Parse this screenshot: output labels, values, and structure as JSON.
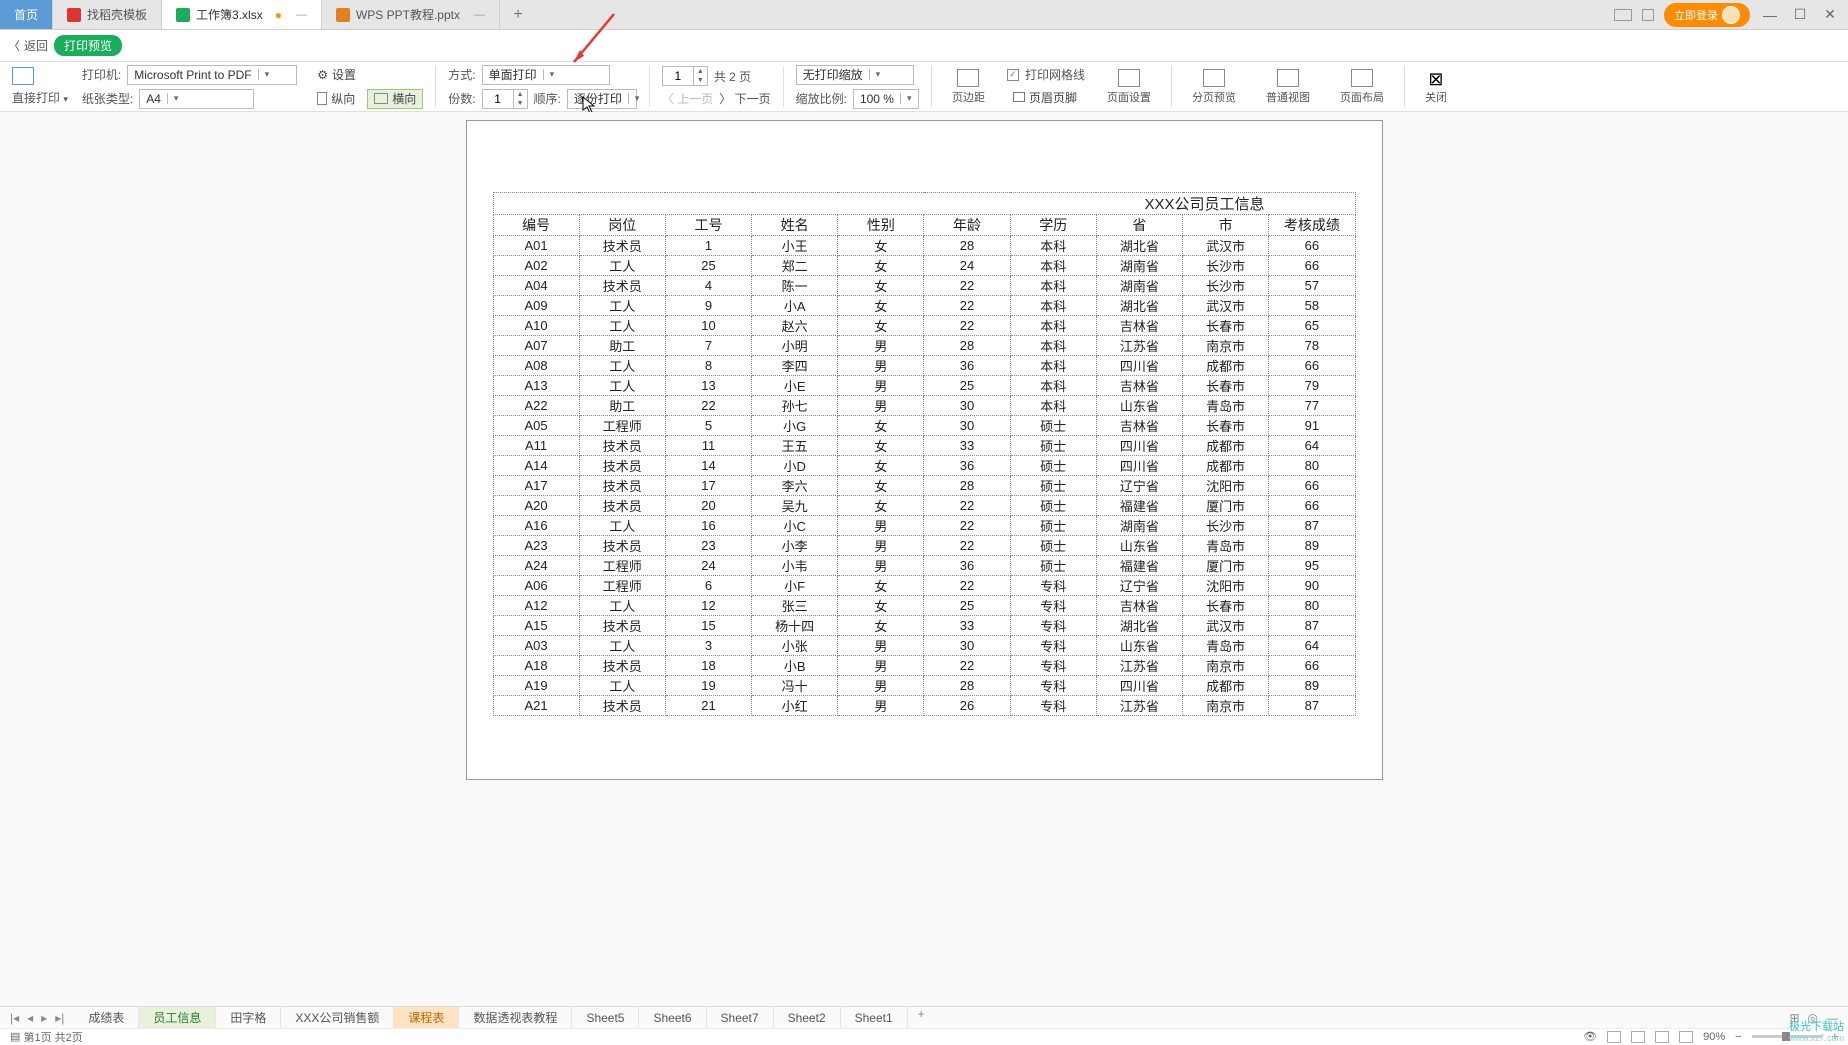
{
  "tabs": {
    "home": "首页",
    "t1": "找稻壳模板",
    "t2": "工作簿3.xlsx",
    "t3": "WPS PPT教程.pptx"
  },
  "topright": {
    "login": "立即登录"
  },
  "subbar": {
    "back": "返回",
    "badge": "打印预览"
  },
  "toolbar": {
    "direct_print": "直接打印",
    "printer_lbl": "打印机:",
    "printer_val": "Microsoft Print to PDF",
    "paper_lbl": "纸张类型:",
    "paper_val": "A4",
    "settings": "设置",
    "portrait": "纵向",
    "landscape": "横向",
    "mode_lbl": "方式:",
    "mode_val": "单面打印",
    "copies_lbl": "份数:",
    "copies_val": "1",
    "order_lbl": "顺序:",
    "order_val": "逐份打印",
    "page_val": "1",
    "total_pages": "共 2 页",
    "prev": "上一页",
    "next": "下一页",
    "scale_mode": "无打印缩放",
    "scale_lbl": "缩放比例:",
    "scale_val": "100 %",
    "margins": "页边距",
    "gridlines": "打印网格线",
    "headerfooter": "页眉页脚",
    "pagesetup": "页面设置",
    "pagebreak": "分页预览",
    "normalview": "普通视图",
    "pagelayout": "页面布局",
    "close": "关闭"
  },
  "table": {
    "title": "XXX公司员工信息",
    "headers": [
      "编号",
      "岗位",
      "工号",
      "姓名",
      "性别",
      "年龄",
      "学历",
      "省",
      "市",
      "考核成绩"
    ],
    "rows": [
      [
        "A01",
        "技术员",
        "1",
        "小王",
        "女",
        "28",
        "本科",
        "湖北省",
        "武汉市",
        "66"
      ],
      [
        "A02",
        "工人",
        "25",
        "郑二",
        "女",
        "24",
        "本科",
        "湖南省",
        "长沙市",
        "66"
      ],
      [
        "A04",
        "技术员",
        "4",
        "陈一",
        "女",
        "22",
        "本科",
        "湖南省",
        "长沙市",
        "57"
      ],
      [
        "A09",
        "工人",
        "9",
        "小A",
        "女",
        "22",
        "本科",
        "湖北省",
        "武汉市",
        "58"
      ],
      [
        "A10",
        "工人",
        "10",
        "赵六",
        "女",
        "22",
        "本科",
        "吉林省",
        "长春市",
        "65"
      ],
      [
        "A07",
        "助工",
        "7",
        "小明",
        "男",
        "28",
        "本科",
        "江苏省",
        "南京市",
        "78"
      ],
      [
        "A08",
        "工人",
        "8",
        "李四",
        "男",
        "36",
        "本科",
        "四川省",
        "成都市",
        "66"
      ],
      [
        "A13",
        "工人",
        "13",
        "小E",
        "男",
        "25",
        "本科",
        "吉林省",
        "长春市",
        "79"
      ],
      [
        "A22",
        "助工",
        "22",
        "孙七",
        "男",
        "30",
        "本科",
        "山东省",
        "青岛市",
        "77"
      ],
      [
        "A05",
        "工程师",
        "5",
        "小G",
        "女",
        "30",
        "硕士",
        "吉林省",
        "长春市",
        "91"
      ],
      [
        "A11",
        "技术员",
        "11",
        "王五",
        "女",
        "33",
        "硕士",
        "四川省",
        "成都市",
        "64"
      ],
      [
        "A14",
        "技术员",
        "14",
        "小D",
        "女",
        "36",
        "硕士",
        "四川省",
        "成都市",
        "80"
      ],
      [
        "A17",
        "技术员",
        "17",
        "李六",
        "女",
        "28",
        "硕士",
        "辽宁省",
        "沈阳市",
        "66"
      ],
      [
        "A20",
        "技术员",
        "20",
        "吴九",
        "女",
        "22",
        "硕士",
        "福建省",
        "厦门市",
        "66"
      ],
      [
        "A16",
        "工人",
        "16",
        "小C",
        "男",
        "22",
        "硕士",
        "湖南省",
        "长沙市",
        "87"
      ],
      [
        "A23",
        "技术员",
        "23",
        "小李",
        "男",
        "22",
        "硕士",
        "山东省",
        "青岛市",
        "89"
      ],
      [
        "A24",
        "工程师",
        "24",
        "小韦",
        "男",
        "36",
        "硕士",
        "福建省",
        "厦门市",
        "95"
      ],
      [
        "A06",
        "工程师",
        "6",
        "小F",
        "女",
        "22",
        "专科",
        "辽宁省",
        "沈阳市",
        "90"
      ],
      [
        "A12",
        "工人",
        "12",
        "张三",
        "女",
        "25",
        "专科",
        "吉林省",
        "长春市",
        "80"
      ],
      [
        "A15",
        "技术员",
        "15",
        "杨十四",
        "女",
        "33",
        "专科",
        "湖北省",
        "武汉市",
        "87"
      ],
      [
        "A03",
        "工人",
        "3",
        "小张",
        "男",
        "30",
        "专科",
        "山东省",
        "青岛市",
        "64"
      ],
      [
        "A18",
        "技术员",
        "18",
        "小B",
        "男",
        "22",
        "专科",
        "江苏省",
        "南京市",
        "66"
      ],
      [
        "A19",
        "工人",
        "19",
        "冯十",
        "男",
        "28",
        "专科",
        "四川省",
        "成都市",
        "89"
      ],
      [
        "A21",
        "技术员",
        "21",
        "小红",
        "男",
        "26",
        "专科",
        "江苏省",
        "南京市",
        "87"
      ]
    ]
  },
  "sheets": {
    "s1": "成绩表",
    "s2": "员工信息",
    "s3": "田字格",
    "s4": "XXX公司销售额",
    "s5": "课程表",
    "s6": "数据透视表教程",
    "s7": "Sheet5",
    "s8": "Sheet6",
    "s9": "Sheet7",
    "s10": "Sheet2",
    "s11": "Sheet1"
  },
  "status": {
    "page": "第1页 共2页",
    "zoom": "90%"
  },
  "watermark": {
    "a": "极光下载站",
    "b": "www.xz7.com"
  }
}
